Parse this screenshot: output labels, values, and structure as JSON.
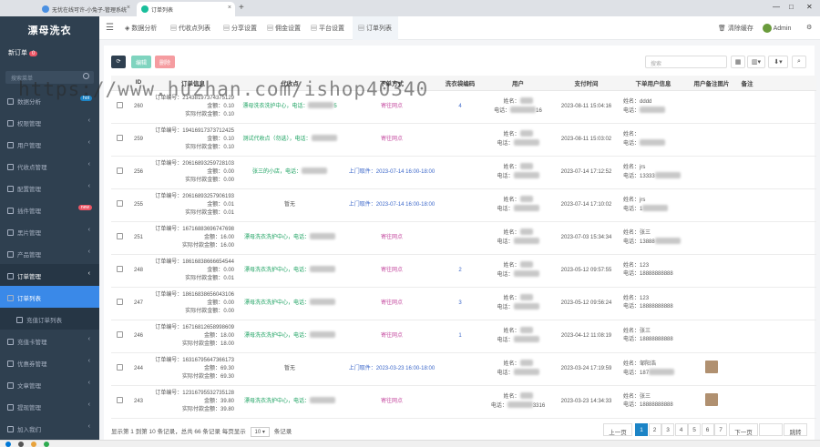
{
  "browser": {
    "tabs": [
      {
        "label": "无忧在线可许-小兔子-管理系统"
      },
      {
        "label": "订单列表"
      }
    ]
  },
  "sidebar": {
    "brand": "漂母洗衣",
    "new_order_label": "新订单",
    "new_order_count": "0",
    "search_placeholder": "搜索菜单",
    "items": [
      {
        "label": "数据分析",
        "icon": "chart-icon",
        "tag": "hot",
        "tag_color": "#1c84c6"
      },
      {
        "label": "权限管理",
        "icon": "lock-icon"
      },
      {
        "label": "用户管理",
        "icon": "user-icon"
      },
      {
        "label": "代收点管理",
        "icon": "store-icon"
      },
      {
        "label": "配置管理",
        "icon": "gear-icon"
      },
      {
        "label": "插件管理",
        "icon": "plugin-icon",
        "tag": "new",
        "tag_color": "#ed5565"
      },
      {
        "label": "黑片管理",
        "icon": "image-icon"
      },
      {
        "label": "产品管理",
        "icon": "box-icon"
      },
      {
        "label": "订单管理",
        "icon": "cart-icon"
      },
      {
        "label": "订单列表",
        "icon": "list-icon"
      },
      {
        "label": "充值订单列表",
        "icon": "list-icon"
      },
      {
        "label": "充值卡管理",
        "icon": "dollar-icon"
      },
      {
        "label": "优惠券管理",
        "icon": "coupon-icon"
      },
      {
        "label": "文章管理",
        "icon": "doc-icon"
      },
      {
        "label": "提现管理",
        "icon": "wallet-icon"
      },
      {
        "label": "加入我们",
        "icon": "team-icon"
      }
    ]
  },
  "topbar": {
    "tabs": [
      "数据分析",
      "代收点列表",
      "分享设置",
      "佣金设置",
      "平台设置",
      "订单列表"
    ],
    "clear_cache": "清除缓存",
    "user": "Admin"
  },
  "toolbar": {
    "edit_label": "编辑",
    "delete_label": "删除",
    "search_placeholder": "搜索"
  },
  "table": {
    "columns": [
      "ID",
      "订单信息",
      "代收点",
      "下单方式",
      "洗衣袋编码",
      "用户",
      "支付时间",
      "下单用户信息",
      "用户备注图片",
      "备注"
    ],
    "labels": {
      "order_no": "订单编号：",
      "amount": "金额：",
      "paid": "实际付款金额：",
      "name": "姓名：",
      "phone": "电话："
    },
    "rows": [
      {
        "id": "260",
        "order_no": "21438197374375129",
        "amount": "0.10",
        "paid": "0.10",
        "station": "漂母洗衣洗护中心，电话：",
        "station_tail": "5",
        "method": "寄往网点",
        "method_color": "pink",
        "bag": "4",
        "user_name": "",
        "user_phone_tail": "16",
        "pay_time": "2023-08-11 15:04:16",
        "buyer_name": "dddd",
        "buyer_phone": "",
        "has_image": false
      },
      {
        "id": "259",
        "order_no": "19416917373712425",
        "amount": "0.10",
        "paid": "0.10",
        "station": "测试代收点（勿选），电话：",
        "station_tail": "",
        "method": "寄往网点",
        "method_color": "pink",
        "bag": "",
        "user_name": "",
        "user_phone_tail": "",
        "pay_time": "2023-08-11 15:03:02",
        "buyer_name": "",
        "buyer_phone": "",
        "has_image": false
      },
      {
        "id": "256",
        "order_no": "20616893259728103",
        "amount": "0.00",
        "paid": "0.00",
        "station": "张三的小店，电话：",
        "station_tail": "",
        "method": "上门取件：2023-07-14 16:00-18:00",
        "method_color": "blue",
        "bag": "",
        "user_name": "",
        "user_phone_tail": "",
        "pay_time": "2023-07-14 17:12:52",
        "buyer_name": "jrs",
        "buyer_phone": "13333",
        "has_image": false
      },
      {
        "id": "255",
        "order_no": "20616893257906193",
        "amount": "0.01",
        "paid": "0.01",
        "station": "暂无",
        "station_tail": "",
        "method": "上门取件：2023-07-14 16:00-18:00",
        "method_color": "blue",
        "bag": "",
        "user_name": "",
        "user_phone_tail": "",
        "pay_time": "2023-07-14 17:10:02",
        "buyer_name": "jrs",
        "buyer_phone": "1",
        "has_image": false
      },
      {
        "id": "251",
        "order_no": "16716883696747698",
        "amount": "16.00",
        "paid": "16.00",
        "station": "漂母洗衣洗护中心，电话：",
        "station_tail": "",
        "method": "寄往网点",
        "method_color": "pink",
        "bag": "",
        "user_name": "",
        "user_phone_tail": "",
        "pay_time": "2023-07-03 15:34:34",
        "buyer_name": "张三",
        "buyer_phone": "13888",
        "has_image": false
      },
      {
        "id": "248",
        "order_no": "18616838666654544",
        "amount": "0.00",
        "paid": "0.01",
        "station": "漂母洗衣洗护中心，电话：",
        "station_tail": "",
        "method": "寄往网点",
        "method_color": "pink",
        "bag": "2",
        "user_name": "",
        "user_phone_tail": "",
        "pay_time": "2023-05-12 09:57:55",
        "buyer_name": "123",
        "buyer_phone": "18888888888",
        "has_image": false
      },
      {
        "id": "247",
        "order_no": "18616838656043106",
        "amount": "0.00",
        "paid": "0.00",
        "station": "漂母洗衣洗护中心，电话：",
        "station_tail": "",
        "method": "寄往网点",
        "method_color": "pink",
        "bag": "3",
        "user_name": "",
        "user_phone_tail": "",
        "pay_time": "2023-05-12 09:56:24",
        "buyer_name": "123",
        "buyer_phone": "18888888888",
        "has_image": false
      },
      {
        "id": "246",
        "order_no": "16716812658998609",
        "amount": "18.00",
        "paid": "18.00",
        "station": "漂母洗衣洗护中心，电话：",
        "station_tail": "",
        "method": "寄往网点",
        "method_color": "pink",
        "bag": "1",
        "user_name": "",
        "user_phone_tail": "",
        "pay_time": "2023-04-12 11:08:19",
        "buyer_name": "张三",
        "buyer_phone": "18888888888",
        "has_image": false
      },
      {
        "id": "244",
        "order_no": "16316795647366173",
        "amount": "69.30",
        "paid": "69.30",
        "station": "暂无",
        "station_tail": "",
        "method": "上门取件：2023-03-23 16:00-18:00",
        "method_color": "blue",
        "bag": "",
        "user_name": "",
        "user_phone_tail": "",
        "pay_time": "2023-03-24 17:19:59",
        "buyer_name": "邹阳浩",
        "buyer_phone": "187",
        "has_image": true
      },
      {
        "id": "243",
        "order_no": "12316795532735128",
        "amount": "39.80",
        "paid": "39.80",
        "station": "漂母洗衣洗护中心，电话：",
        "station_tail": "",
        "method": "寄往网点",
        "method_color": "pink",
        "bag": "",
        "user_name": "",
        "user_phone_tail": "3316",
        "pay_time": "2023-03-23 14:34:33",
        "buyer_name": "张三",
        "buyer_phone": "18888888888",
        "has_image": true
      }
    ]
  },
  "footer": {
    "summary_pre": "显示第 1 到第 10 条记录，总共 66 条记录 每页显示",
    "page_size": "10",
    "summary_post": "条记录",
    "prev": "上一页",
    "next": "下一页",
    "pages": [
      "1",
      "2",
      "3",
      "4",
      "5",
      "6",
      "7"
    ],
    "jump": "跳转"
  },
  "watermark": "https://www.huzhan.com/ishop40340"
}
